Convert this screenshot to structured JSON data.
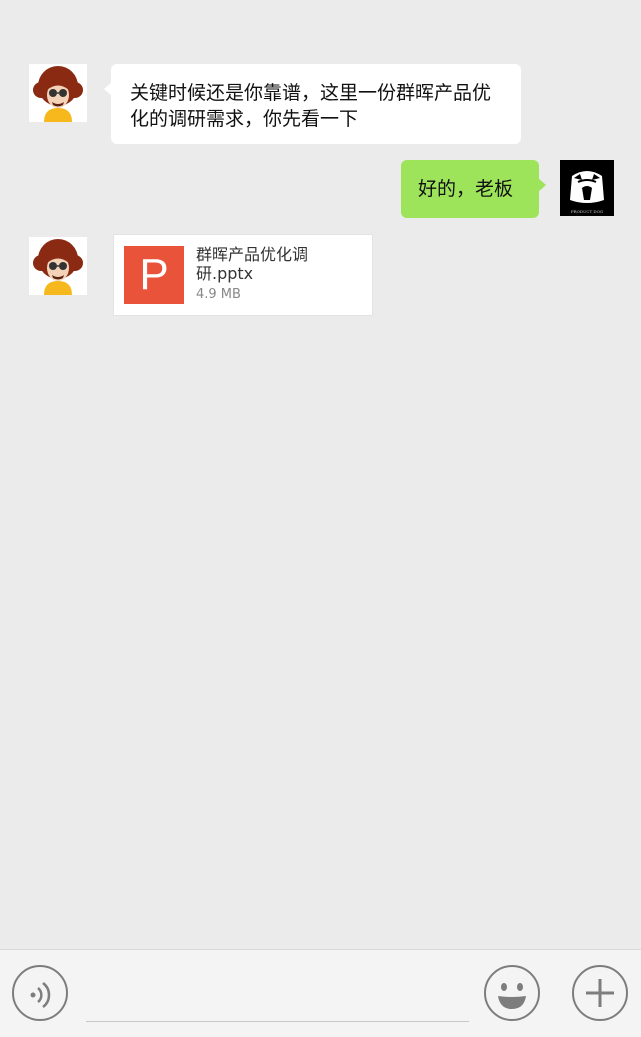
{
  "messages": [
    {
      "from": "boss",
      "text": "关键时候还是你靠谱，这里一份群晖产品优化的调研需求，你先看一下"
    },
    {
      "from": "me",
      "text": "好的，老板"
    }
  ],
  "file": {
    "name": "群晖产品优化调研.pptx",
    "size": "4.9 MB",
    "icon_letter": "P",
    "icon_color": "#e8533a"
  },
  "avatars": {
    "boss": "afro-cartoon-avatar",
    "me": "product-dog-avatar",
    "me_caption": "PRODUCT DOG"
  },
  "input_bar": {
    "voice": "voice-icon",
    "emoji": "emoji-icon",
    "plus": "plus-icon"
  },
  "colors": {
    "background": "#ebebeb",
    "my_bubble": "#9de45a",
    "their_bubble": "#ffffff"
  }
}
